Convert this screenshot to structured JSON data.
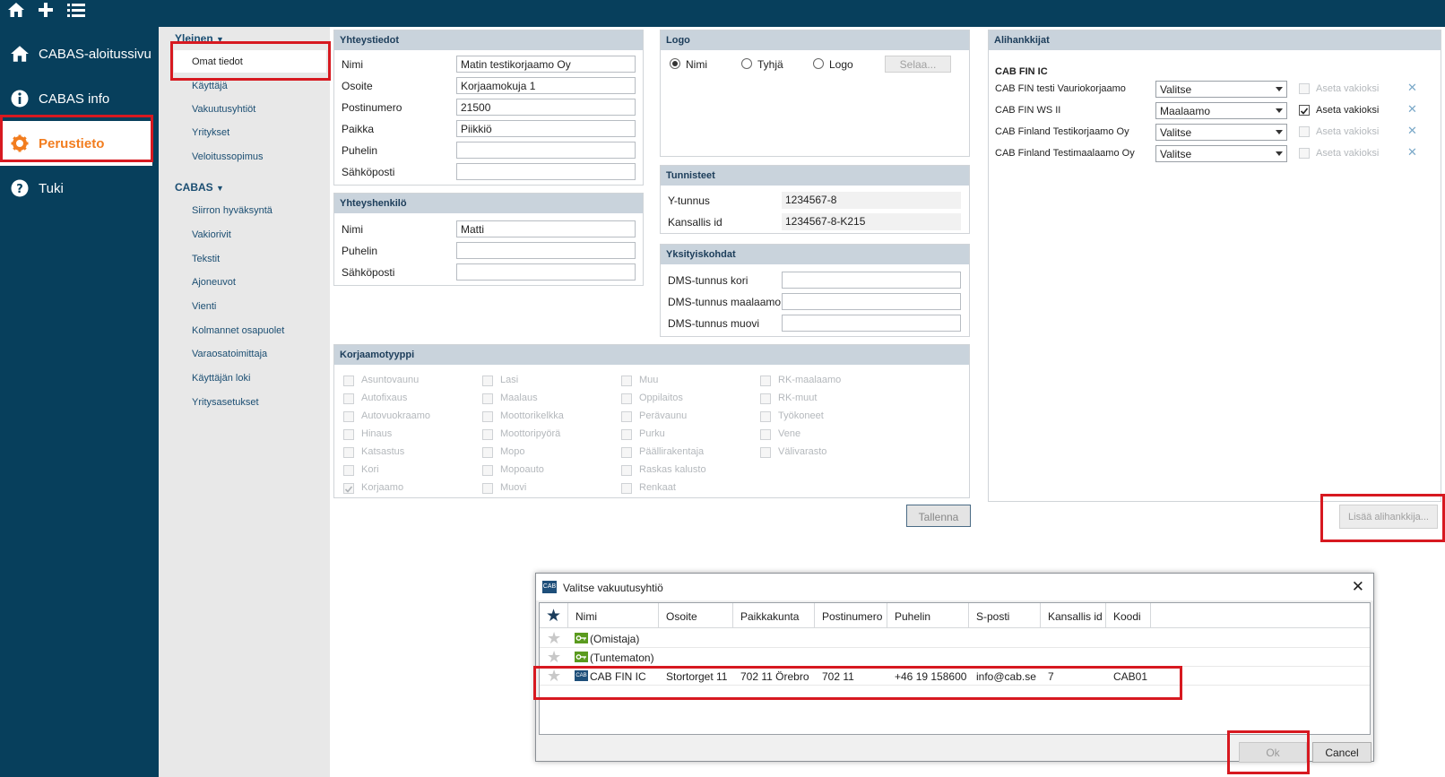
{
  "topbar": {
    "icons": [
      "home-icon",
      "plus-icon",
      "list-icon"
    ]
  },
  "nav": {
    "items": [
      {
        "label": "CABAS-aloitussivu",
        "icon": "home-icon"
      },
      {
        "label": "CABAS info",
        "icon": "info-icon"
      },
      {
        "label": "Perustieto",
        "icon": "gear-icon"
      },
      {
        "label": "Tuki",
        "icon": "help-icon"
      }
    ]
  },
  "subnav": {
    "group1": "Yleinen",
    "group1_items": [
      "Omat tiedot",
      "Käyttäjä",
      "Vakuutusyhtiöt",
      "Yritykset",
      "Veloitussopimus"
    ],
    "group2": "CABAS",
    "group2_items": [
      "Siirron hyväksyntä",
      "Vakiorivit",
      "Tekstit",
      "Ajoneuvot",
      "Vienti",
      "Kolmannet osapuolet",
      "Varaosatoimittaja",
      "Käyttäjän loki",
      "Yritysasetukset"
    ]
  },
  "yhteystiedot": {
    "title": "Yhteystiedot",
    "rows": [
      {
        "label": "Nimi",
        "value": "Matin testikorjaamo Oy"
      },
      {
        "label": "Osoite",
        "value": "Korjaamokuja 1"
      },
      {
        "label": "Postinumero",
        "value": "21500"
      },
      {
        "label": "Paikka",
        "value": "Piikkiö"
      },
      {
        "label": "Puhelin",
        "value": ""
      },
      {
        "label": "Sähköposti",
        "value": ""
      }
    ]
  },
  "yhteyshenkilo": {
    "title": "Yhteyshenkilö",
    "rows": [
      {
        "label": "Nimi",
        "value": "Matti"
      },
      {
        "label": "Puhelin",
        "value": ""
      },
      {
        "label": "Sähköposti",
        "value": ""
      }
    ]
  },
  "logo": {
    "title": "Logo",
    "options": [
      "Nimi",
      "Tyhjä",
      "Logo"
    ],
    "selected": "Nimi",
    "browse": "Selaa..."
  },
  "tunnisteet": {
    "title": "Tunnisteet",
    "rows": [
      {
        "label": "Y-tunnus",
        "value": "1234567-8"
      },
      {
        "label": "Kansallis id",
        "value": "1234567-8-K215"
      }
    ]
  },
  "yksityiskohdat": {
    "title": "Yksityiskohdat",
    "rows": [
      {
        "label": "DMS-tunnus kori",
        "value": ""
      },
      {
        "label": "DMS-tunnus maalaamo",
        "value": ""
      },
      {
        "label": "DMS-tunnus muovi",
        "value": ""
      }
    ]
  },
  "korjaamotyyppi": {
    "title": "Korjaamotyyppi",
    "columns": [
      [
        "Asuntovaunu",
        "Autofixaus",
        "Autovuokraamo",
        "Hinaus",
        "Katsastus",
        "Kori",
        "Korjaamo"
      ],
      [
        "Lasi",
        "Maalaus",
        "Moottorikelkka",
        "Moottoripyörä",
        "Mopo",
        "Mopoauto",
        "Muovi"
      ],
      [
        "Muu",
        "Oppilaitos",
        "Perävaunu",
        "Purku",
        "Päällirakentaja",
        "Raskas kalusto",
        "Renkaat"
      ],
      [
        "RK-maalaamo",
        "RK-muut",
        "Työkoneet",
        "Vene",
        "Välivarasto"
      ]
    ],
    "checked": [
      "Korjaamo"
    ]
  },
  "save_button": "Tallenna",
  "alihankkijat": {
    "title": "Alihankkijat",
    "group": "CAB FIN IC",
    "rows": [
      {
        "name": "CAB FIN testi Vauriokorjaamo",
        "select": "Valitse",
        "default_label": "Aseta vakioksi",
        "checked": false
      },
      {
        "name": "CAB FIN WS II",
        "select": "Maalaamo",
        "default_label": "Aseta vakioksi",
        "checked": true
      },
      {
        "name": "CAB Finland Testikorjaamo Oy",
        "select": "Valitse",
        "default_label": "Aseta vakioksi",
        "checked": false
      },
      {
        "name": "CAB Finland Testimaalaamo Oy",
        "select": "Valitse",
        "default_label": "Aseta vakioksi",
        "checked": false
      }
    ],
    "add_button": "Lisää alihankkija..."
  },
  "dialog": {
    "title": "Valitse vakuutusyhtiö",
    "app_badge": "CAB",
    "columns": [
      "Nimi",
      "Osoite",
      "Paikkakunta",
      "Postinumero",
      "Puhelin",
      "S-posti",
      "Kansallis id",
      "Koodi"
    ],
    "rows": [
      {
        "name": "(Omistaja)",
        "icon": "key-icon",
        "cells": [
          "",
          "",
          "",
          "",
          "",
          "",
          ""
        ]
      },
      {
        "name": "(Tuntematon)",
        "icon": "key-icon",
        "cells": [
          "",
          "",
          "",
          "",
          "",
          "",
          ""
        ]
      },
      {
        "name": "CAB FIN IC",
        "icon": "cab-icon",
        "cells": [
          "Stortorget 11",
          "702 11 Örebro",
          "702 11",
          "+46 19 158600",
          "info@cab.se",
          "7",
          "CAB01"
        ]
      }
    ],
    "ok": "Ok",
    "cancel": "Cancel"
  },
  "colors": {
    "nav_bg": "#073f5c",
    "accent": "#f27d1f",
    "highlight": "#d71920",
    "panel_header": "#c9d3dc"
  }
}
